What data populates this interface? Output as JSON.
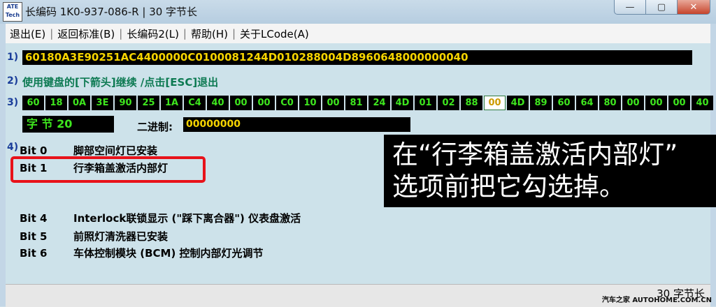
{
  "window": {
    "logo_text": "ATE Tech",
    "title": "长编码   1K0-937-086-R | 30 字节长",
    "controls": [
      "—",
      "▢",
      "✕"
    ]
  },
  "menu": [
    "退出(E)",
    "返回标准(B)",
    "长编码2(L)",
    "帮助(H)",
    "关于LCode(A)"
  ],
  "rows": {
    "r1": "1)",
    "r2": "2)",
    "r3": "3)",
    "r4": "4)"
  },
  "hex_code": "60180A3E90251AC4400000C0100081244D010288004D8960648000000040",
  "instruction": "使用键盘的[下箭头]继续 /点击[ESC]退出",
  "bytes": [
    "60",
    "18",
    "0A",
    "3E",
    "90",
    "25",
    "1A",
    "C4",
    "40",
    "00",
    "00",
    "C0",
    "10",
    "00",
    "81",
    "24",
    "4D",
    "01",
    "02",
    "88",
    "00",
    "4D",
    "89",
    "60",
    "64",
    "80",
    "00",
    "00",
    "00",
    "40"
  ],
  "selected_byte_index": 20,
  "byte_label": "字 节 20",
  "binary_label": "二进制:",
  "binary_value": "00000000",
  "bits": [
    {
      "bit": "Bit 0",
      "desc": "脚部空间灯已安装"
    },
    {
      "bit": "Bit 1",
      "desc": "行李箱盖激活内部灯"
    },
    {
      "bit": "Bit 4",
      "desc": "Interlock联锁显示 (\"踩下离合器\") 仪表盘激活"
    },
    {
      "bit": "Bit 5",
      "desc": "前照灯清洗器已安装"
    },
    {
      "bit": "Bit 6",
      "desc": "车体控制模块 (BCM) 控制内部灯光调节"
    }
  ],
  "overlay": {
    "line1": "在“行李箱盖激活内部灯”",
    "line2": "选项前把它勾选掉。"
  },
  "status": "30 字节长",
  "watermark": "汽车之家 AUTOHOME.COM.CN"
}
